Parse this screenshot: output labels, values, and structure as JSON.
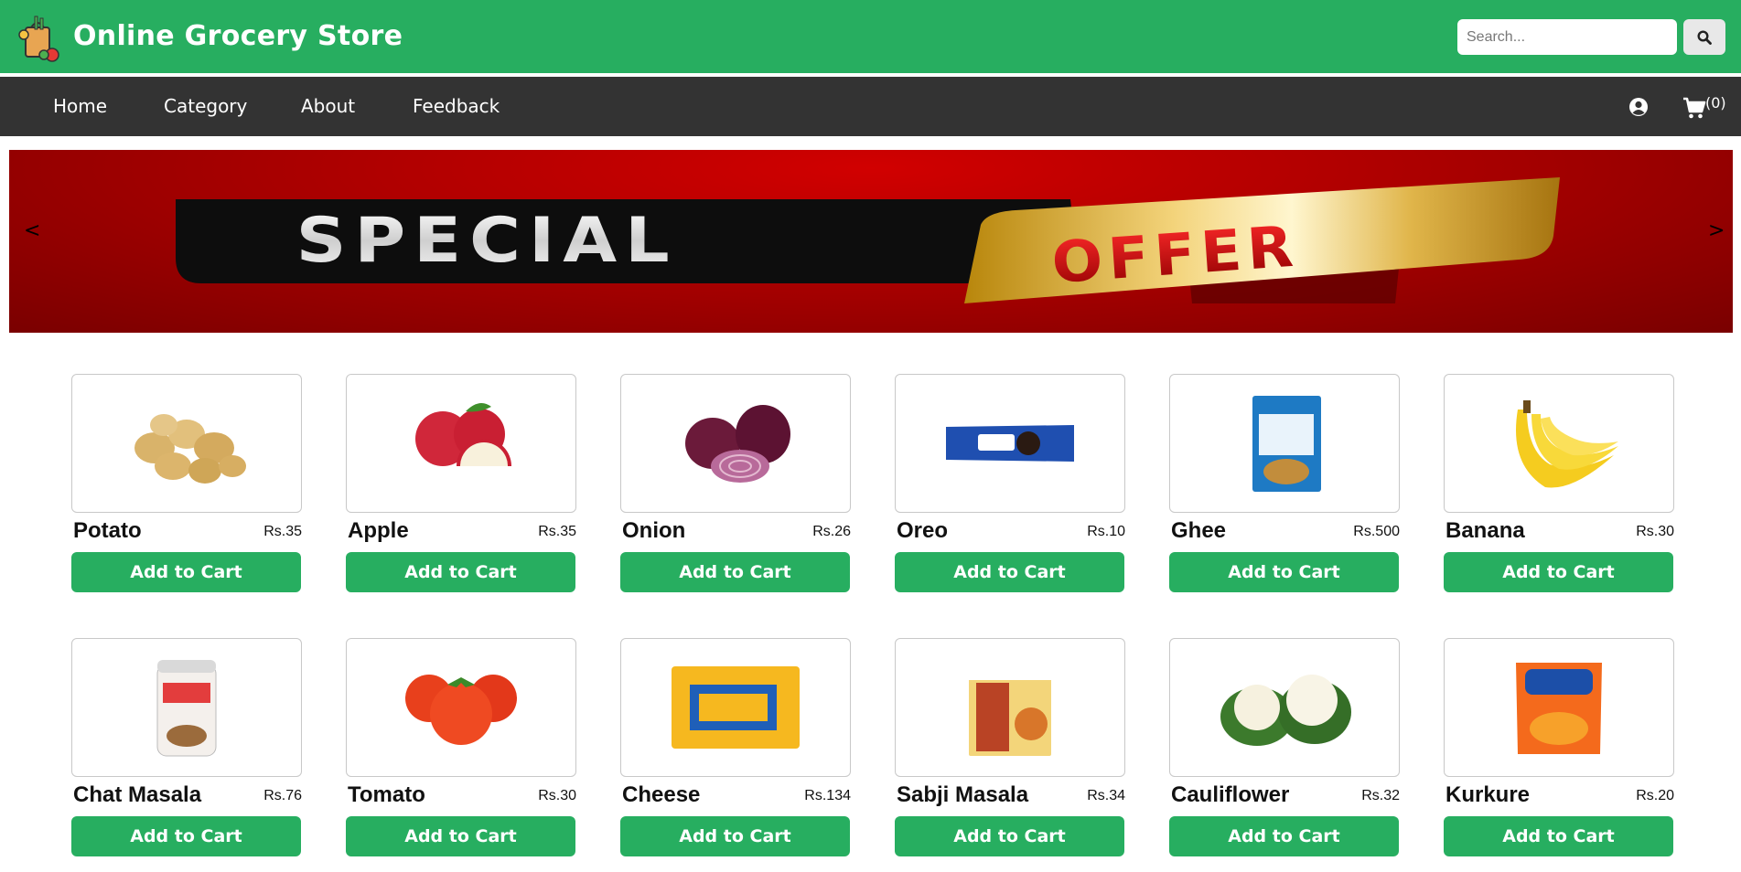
{
  "header": {
    "brand": "Online Grocery Store",
    "logo_icon": "grocery-bag-icon",
    "search_placeholder": "Search...",
    "search_icon": "search-icon",
    "bg_color": "#27ae60"
  },
  "nav": {
    "items": [
      "Home",
      "Category",
      "About",
      "Feedback"
    ],
    "user_icon": "user-circle-icon",
    "cart_icon": "cart-icon",
    "cart_count": "(0)",
    "bg_color": "#333333"
  },
  "banner": {
    "left_arrow": "<",
    "right_arrow": ">",
    "text_special": "SPECIAL",
    "text_offer": "OFFER"
  },
  "products": [
    {
      "name": "Potato",
      "price": "Rs.35",
      "button": "Add to Cart",
      "icon": "potato-icon"
    },
    {
      "name": "Apple",
      "price": "Rs.35",
      "button": "Add to Cart",
      "icon": "apple-icon"
    },
    {
      "name": "Onion",
      "price": "Rs.26",
      "button": "Add to Cart",
      "icon": "onion-icon"
    },
    {
      "name": "Oreo",
      "price": "Rs.10",
      "button": "Add to Cart",
      "icon": "biscuit-pack-icon"
    },
    {
      "name": "Ghee",
      "price": "Rs.500",
      "button": "Add to Cart",
      "icon": "ghee-pack-icon"
    },
    {
      "name": "Banana",
      "price": "Rs.30",
      "button": "Add to Cart",
      "icon": "banana-icon"
    },
    {
      "name": "Chat Masala",
      "price": "Rs.76",
      "button": "Add to Cart",
      "icon": "spice-jar-icon"
    },
    {
      "name": "Tomato",
      "price": "Rs.30",
      "button": "Add to Cart",
      "icon": "tomato-icon"
    },
    {
      "name": "Cheese",
      "price": "Rs.134",
      "button": "Add to Cart",
      "icon": "cheese-pack-icon"
    },
    {
      "name": "Sabji Masala",
      "price": "Rs.34",
      "button": "Add to Cart",
      "icon": "masala-box-icon"
    },
    {
      "name": "Cauliflower",
      "price": "Rs.32",
      "button": "Add to Cart",
      "icon": "cauliflower-icon"
    },
    {
      "name": "Kurkure",
      "price": "Rs.20",
      "button": "Add to Cart",
      "icon": "snack-pack-icon"
    }
  ],
  "colors": {
    "accent_green": "#27ae60",
    "nav_dark": "#333333"
  }
}
